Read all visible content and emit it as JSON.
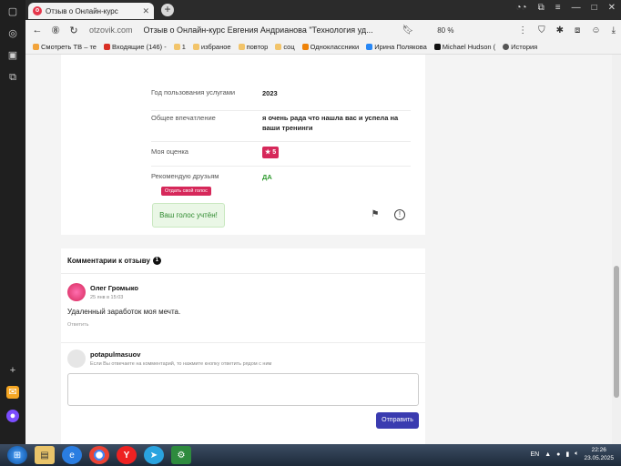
{
  "browser": {
    "tab_title": "Отзыв о Онлайн-курс",
    "tab_close": "✕",
    "new_tab": "+",
    "address_domain": "otzovik.com",
    "page_title": "Отзыв о Онлайн-курс Евгения Андрианова \"Технология уд...",
    "zoom": "80 %",
    "bookmarks": [
      "Смотреть ТВ – те",
      "Входящие (146) -",
      "1",
      "избраное",
      "повтор",
      "соц",
      "Одноклассники",
      "Ирина Полякова",
      "Michael Hudson (",
      "История"
    ]
  },
  "review": {
    "rows": [
      {
        "key": "Год пользования услугами",
        "value": "2023"
      },
      {
        "key": "Общее впечатление",
        "value": "я очень рада что нашла вас и успела на ваши тренинги"
      },
      {
        "key": "Моя оценка",
        "value": "5"
      },
      {
        "key": "Рекомендую друзьям",
        "value": "ДА"
      }
    ],
    "tooltip": "Отдать свой голос",
    "voted": "Ваш голос учтён!"
  },
  "comments": {
    "title": "Комментарии к отзыву",
    "count": "1",
    "items": [
      {
        "author": "Олег Громыко",
        "date": "25 янв в 15:03",
        "text": "Удаленный заработок моя мечта.",
        "reply": "Ответить"
      }
    ],
    "form": {
      "user": "potapulmasuov",
      "hint": "Если Вы отвечаете на комментарий, то нажмите кнопку ответить рядом с ним",
      "send": "Отправить"
    }
  },
  "taskbar": {
    "lang": "EN",
    "time": "22:26",
    "date": "23.05.2025"
  },
  "colors": {
    "accent": "#d6285a",
    "button": "#3a3bb0",
    "success": "#2e9a2e"
  }
}
